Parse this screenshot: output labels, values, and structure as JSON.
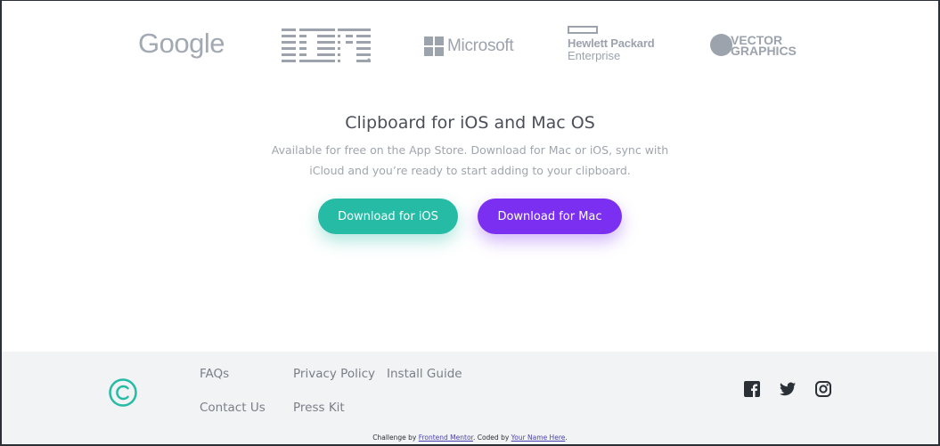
{
  "logos": {
    "google": "Google",
    "ibm": "IBM",
    "microsoft": "Microsoft",
    "hpe_line1": "Hewlett Packard",
    "hpe_line2": "Enterprise",
    "vector_line1": "VECTOR",
    "vector_line2": "GRAPHICS"
  },
  "cta": {
    "title": "Clipboard for iOS and Mac OS",
    "description": "Available for free on the App Store. Download for Mac or iOS, sync with iCloud and you’re ready to start adding to your clipboard.",
    "ios_button": "Download for iOS",
    "mac_button": "Download for Mac"
  },
  "colors": {
    "ios_button": "#26bba4",
    "mac_button": "#7b2ff0",
    "footer_bg": "#f1f3f4",
    "logo_gray": "#9ca3ad",
    "brand_teal": "#26bba4"
  },
  "footer": {
    "logo_icon": "clipboard-copyright-logo",
    "links": {
      "faqs": "FAQs",
      "contact": "Contact Us",
      "privacy": "Privacy Policy",
      "press": "Press Kit",
      "install": "Install Guide"
    },
    "social": [
      "facebook-icon",
      "twitter-icon",
      "instagram-icon"
    ],
    "attribution": {
      "prefix": "Challenge by ",
      "fm_link": "Frontend Mentor",
      "middle": ". Coded by ",
      "name_link": "Your Name Here",
      "suffix": "."
    }
  }
}
